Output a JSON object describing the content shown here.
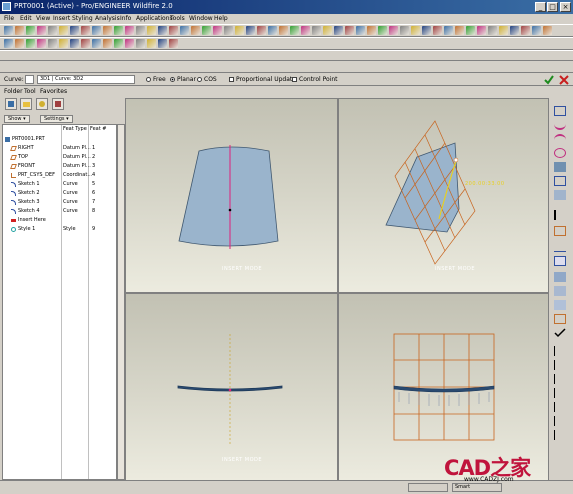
{
  "window": {
    "title": "PRT0001 (Active) - Pro/ENGINEER Wildfire 2.0"
  },
  "menu": [
    "File",
    "Edit",
    "View",
    "Insert",
    "Styling",
    "Analysis",
    "Info",
    "Applications",
    "Tools",
    "Window",
    "Help"
  ],
  "dashboard": {
    "curve_label": "Curve:",
    "curve_field": "3D1 | Curve: 3D2",
    "options": {
      "free": "Free",
      "planar": "Planar",
      "cos": "COS",
      "proportional": "Proportional Update",
      "control_point": "Control Point"
    }
  },
  "navigator": {
    "tabs": [
      "Folder",
      "Tool",
      "Favorites"
    ],
    "show_button": "Show ▾",
    "settings_button": "Settings ▾"
  },
  "tree": {
    "columns": [
      "Feat Type",
      "Feat #"
    ],
    "rows": [
      {
        "name": "PRT0001.PRT",
        "type": "",
        "num": ""
      },
      {
        "name": "RIGHT",
        "type": "Datum Pl…",
        "num": "1"
      },
      {
        "name": "TOP",
        "type": "Datum Pl…",
        "num": "2"
      },
      {
        "name": "FRONT",
        "type": "Datum Pl…",
        "num": "3"
      },
      {
        "name": "PRT_CSYS_DEF",
        "type": "Coordinat…",
        "num": "4"
      },
      {
        "name": "Sketch 1",
        "type": "Curve",
        "num": "5"
      },
      {
        "name": "Sketch 2",
        "type": "Curve",
        "num": "6"
      },
      {
        "name": "Sketch 3",
        "type": "Curve",
        "num": "7"
      },
      {
        "name": "Sketch 4",
        "type": "Curve",
        "num": "8"
      },
      {
        "name": "Insert Here",
        "type": "",
        "num": ""
      },
      {
        "name": "Style 1",
        "type": "Style",
        "num": "9"
      }
    ]
  },
  "viewports": {
    "mode_text": "INSERT MODE",
    "dimension": "200.00:33.00"
  },
  "status": {
    "field1": "",
    "field2": "Smart"
  },
  "watermark": {
    "logo": "CAD之家",
    "url": "www.CADZJ.com"
  },
  "colors": {
    "surface": "#9ab4cc",
    "grid": "#c8641e",
    "curve": "#e0207a",
    "datum_yellow": "#e8d020",
    "confirm": "#1e8a1e",
    "cancel": "#c81e1e"
  }
}
